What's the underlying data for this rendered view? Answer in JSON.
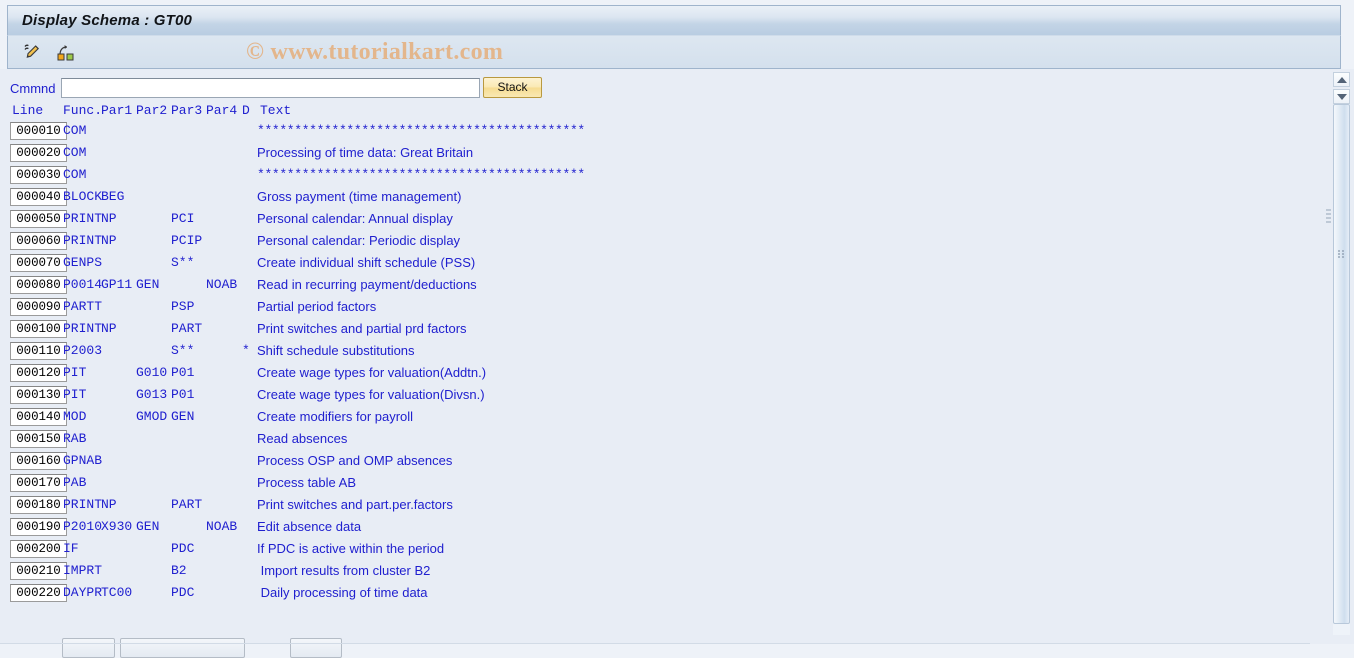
{
  "window": {
    "title": "Display Schema : GT00"
  },
  "toolbar": {
    "icons": [
      {
        "name": "edit-pencil-icon",
        "label": "Change"
      },
      {
        "name": "schema-structure-icon",
        "label": "Structure"
      }
    ],
    "watermark": "© www.tutorialkart.com"
  },
  "command": {
    "label": "Cmmnd",
    "value": "",
    "placeholder": "",
    "stack_label": "Stack"
  },
  "grid": {
    "headers": {
      "line": "Line",
      "func": "Func.",
      "par1": "Par1",
      "par2": "Par2",
      "par3": "Par3",
      "par4": "Par4",
      "d": "D",
      "text": "Text"
    },
    "rows": [
      {
        "line": "000010",
        "func": "COM",
        "par1": "",
        "par2": "",
        "par3": "",
        "par4": "",
        "d": "",
        "text": "********************************************",
        "stars": true
      },
      {
        "line": "000020",
        "func": "COM",
        "par1": "",
        "par2": "",
        "par3": "",
        "par4": "",
        "d": "",
        "text": "Processing of time data: Great Britain",
        "stars": false
      },
      {
        "line": "000030",
        "func": "COM",
        "par1": "",
        "par2": "",
        "par3": "",
        "par4": "",
        "d": "",
        "text": "********************************************",
        "stars": true
      },
      {
        "line": "000040",
        "func": "BLOCK",
        "par1": "BEG",
        "par2": "",
        "par3": "",
        "par4": "",
        "d": "",
        "text": "Gross payment (time management)",
        "stars": false
      },
      {
        "line": "000050",
        "func": "PRINT",
        "par1": "NP",
        "par2": "",
        "par3": "PCI",
        "par4": "",
        "d": "",
        "text": "Personal calendar: Annual display",
        "stars": false
      },
      {
        "line": "000060",
        "func": "PRINT",
        "par1": "NP",
        "par2": "",
        "par3": "PCIP",
        "par4": "",
        "d": "",
        "text": "Personal calendar: Periodic display",
        "stars": false
      },
      {
        "line": "000070",
        "func": "GENPS",
        "par1": "",
        "par2": "",
        "par3": "S**",
        "par4": "",
        "d": "",
        "text": "Create individual shift schedule (PSS)",
        "stars": false
      },
      {
        "line": "000080",
        "func": "P0014",
        "par1": "GP11",
        "par2": "GEN",
        "par3": "",
        "par4": "NOAB",
        "d": "",
        "text": "Read in recurring payment/deductions",
        "stars": false
      },
      {
        "line": "000090",
        "func": "PARTT",
        "par1": "",
        "par2": "",
        "par3": "PSP",
        "par4": "",
        "d": "",
        "text": "Partial period factors",
        "stars": false
      },
      {
        "line": "000100",
        "func": "PRINT",
        "par1": "NP",
        "par2": "",
        "par3": "PART",
        "par4": "",
        "d": "",
        "text": "Print switches and partial prd factors",
        "stars": false
      },
      {
        "line": "000110",
        "func": "P2003",
        "par1": "",
        "par2": "",
        "par3": "S**",
        "par4": "",
        "d": "*",
        "text": "Shift schedule substitutions",
        "stars": false
      },
      {
        "line": "000120",
        "func": "PIT",
        "par1": "",
        "par2": "G010",
        "par3": "P01",
        "par4": "",
        "d": "",
        "text": "Create wage types for valuation(Addtn.)",
        "stars": false
      },
      {
        "line": "000130",
        "func": "PIT",
        "par1": "",
        "par2": "G013",
        "par3": "P01",
        "par4": "",
        "d": "",
        "text": "Create wage types for valuation(Divsn.)",
        "stars": false
      },
      {
        "line": "000140",
        "func": "MOD",
        "par1": "",
        "par2": "GMOD",
        "par3": "GEN",
        "par4": "",
        "d": "",
        "text": "Create modifiers for payroll",
        "stars": false
      },
      {
        "line": "000150",
        "func": "RAB",
        "par1": "",
        "par2": "",
        "par3": "",
        "par4": "",
        "d": "",
        "text": "Read absences",
        "stars": false
      },
      {
        "line": "000160",
        "func": "GPNAB",
        "par1": "",
        "par2": "",
        "par3": "",
        "par4": "",
        "d": "",
        "text": "Process OSP and OMP absences",
        "stars": false
      },
      {
        "line": "000170",
        "func": "PAB",
        "par1": "",
        "par2": "",
        "par3": "",
        "par4": "",
        "d": "",
        "text": "Process table AB",
        "stars": false
      },
      {
        "line": "000180",
        "func": "PRINT",
        "par1": "NP",
        "par2": "",
        "par3": "PART",
        "par4": "",
        "d": "",
        "text": "Print switches and part.per.factors",
        "stars": false
      },
      {
        "line": "000190",
        "func": "P2010",
        "par1": "X930",
        "par2": "GEN",
        "par3": "",
        "par4": "NOAB",
        "d": "",
        "text": "Edit absence data",
        "stars": false
      },
      {
        "line": "000200",
        "func": "IF",
        "par1": "",
        "par2": "",
        "par3": "PDC",
        "par4": "",
        "d": "",
        "text": "If PDC is active within the period",
        "stars": false
      },
      {
        "line": "000210",
        "func": "IMPRT",
        "par1": "",
        "par2": "",
        "par3": "B2",
        "par4": "",
        "d": "",
        "text": " Import results from cluster B2",
        "stars": false
      },
      {
        "line": "000220",
        "func": "DAYPR",
        "par1": "TC00",
        "par2": "",
        "par3": "PDC",
        "par4": "",
        "d": "",
        "text": " Daily processing of time data",
        "stars": false
      }
    ]
  },
  "scrollbar": {
    "up_label": "▲",
    "down_label": "▼"
  }
}
